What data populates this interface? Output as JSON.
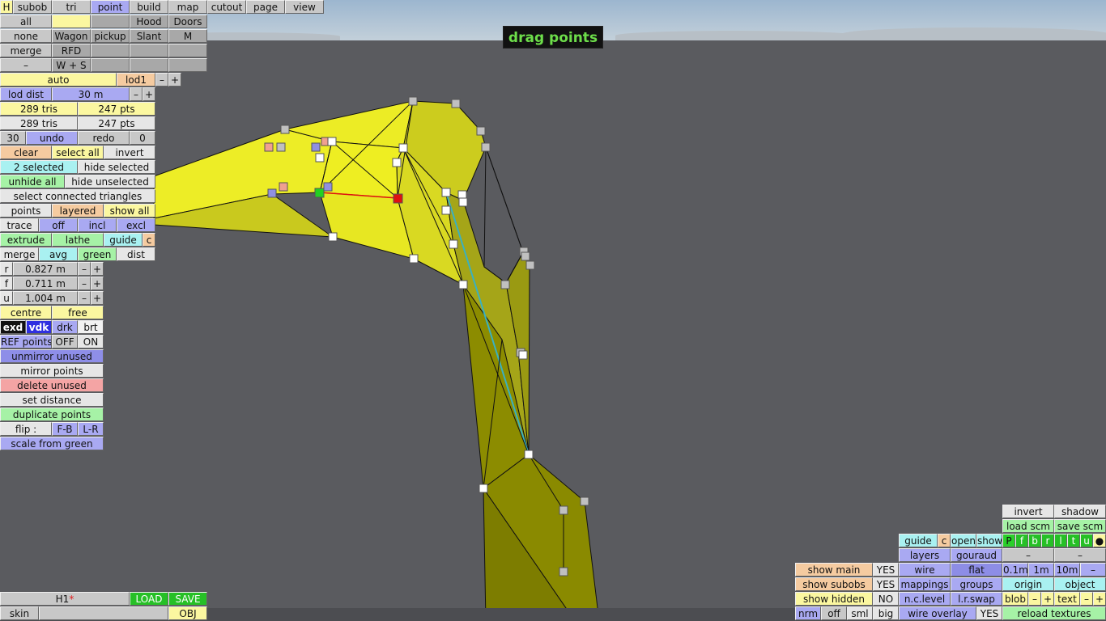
{
  "topbar": {
    "h": "H",
    "subob": "subob",
    "tri": "tri",
    "point": "point",
    "build": "build",
    "map": "map",
    "cutout": "cutout",
    "page": "page",
    "view": "view"
  },
  "left": {
    "r1": [
      "all",
      "",
      "Hood",
      "Doors"
    ],
    "r2": [
      "none",
      "Wagon",
      "pickup",
      "Slant",
      "M"
    ],
    "r3": [
      "merge",
      "RFD",
      "",
      ""
    ],
    "r4": [
      "–",
      "W + S",
      "",
      ""
    ],
    "auto": "auto",
    "lod1": "lod1",
    "minus": "–",
    "plus": "+",
    "lod_dist": "lod dist",
    "lod_dist_val": "30 m",
    "tris1": "289 tris",
    "pts1": "247 pts",
    "tris2": "289 tris",
    "pts2": "247 pts",
    "undo_count": "30",
    "undo": "undo",
    "redo": "redo",
    "redo_count": "0",
    "clear": "clear",
    "select_all": "select all",
    "invert": "invert",
    "selected": "2 selected",
    "hide_selected": "hide selected",
    "unhide_all": "unhide all",
    "hide_unselected": "hide unselected",
    "select_connected": "select connected triangles",
    "points": "points",
    "layered": "layered",
    "show_all": "show all",
    "trace": "trace",
    "off": "off",
    "incl": "incl",
    "excl": "excl",
    "extrude": "extrude",
    "lathe": "lathe",
    "guide": "guide",
    "c": "c",
    "merge2": "merge",
    "avg": "avg",
    "green": "green",
    "dist": "dist",
    "r_lbl": "r",
    "r_val": "0.827 m",
    "f_lbl": "f",
    "f_val": "0.711 m",
    "u_lbl": "u",
    "u_val": "1.004 m",
    "centre": "centre",
    "free": "free",
    "exd": "exd",
    "vdk": "vdk",
    "drk": "drk",
    "brt": "brt",
    "ref_points": "REF points",
    "ref_off": "OFF",
    "ref_on": "ON",
    "unmirror": "unmirror unused",
    "mirror": "mirror points",
    "delete_unused": "delete unused",
    "set_distance": "set distance",
    "duplicate": "duplicate points",
    "flip": "flip :",
    "fb": "F-B",
    "lr": "L-R",
    "scale_green": "scale from green"
  },
  "mode_label": "drag points",
  "bottom_left": {
    "file": "H1",
    "star": "*",
    "load": "LOAD",
    "save": "SAVE",
    "skin": "skin",
    "obj": "OBJ"
  },
  "bottom_right": {
    "invert": "invert",
    "shadow": "shadow",
    "load_scm": "load scm",
    "save_scm": "save scm",
    "guide": "guide",
    "c": "c",
    "open": "open",
    "show": "show",
    "pf": [
      "P",
      "f",
      "b",
      "r",
      "l",
      "t",
      "u",
      "●"
    ],
    "layers": "layers",
    "gouraud": "gouraud",
    "dash": "–",
    "show_main": "show main",
    "yes1": "YES",
    "wire": "wire",
    "flat": "flat",
    "m01": "0.1m",
    "m1": "1m",
    "m10": "10m",
    "show_subobs": "show subobs",
    "yes2": "YES",
    "mappings": "mappings",
    "groups": "groups",
    "origin": "origin",
    "object": "object",
    "show_hidden": "show hidden",
    "no": "NO",
    "nc_level": "n.c.level",
    "lr_swap": "l.r.swap",
    "blob": "blob",
    "text": "text",
    "nrm": "nrm",
    "off": "off",
    "sml": "sml",
    "big": "big",
    "wire_overlay": "wire overlay",
    "yes3": "YES",
    "reload": "reload textures"
  },
  "colors": {
    "mesh_yellow": "#eeee22",
    "mesh_dark": "#8a8a00",
    "bg": "#5a5b5f",
    "label_green": "#6dde4a"
  }
}
